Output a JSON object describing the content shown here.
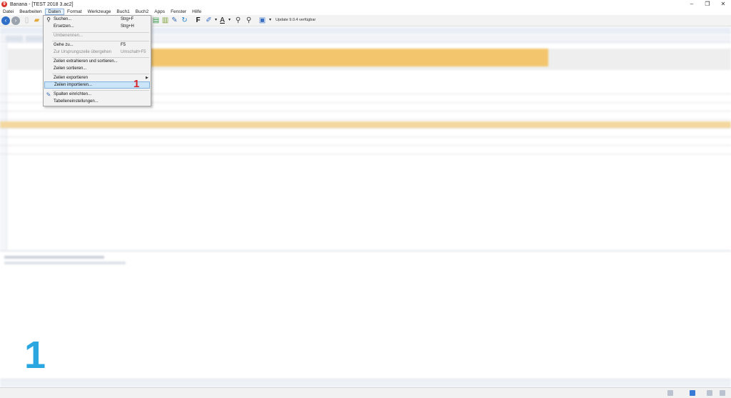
{
  "window": {
    "title": "Banana - [TEST 2018 3.ac2]",
    "controls": [
      "–",
      "❐",
      "✕"
    ]
  },
  "menubar": {
    "items": [
      "Datei",
      "Bearbeiten",
      "Daten",
      "Format",
      "Werkzeuge",
      "Buch1",
      "Buch2",
      "Apps",
      "Fenster",
      "Hilfe"
    ],
    "active": "Daten"
  },
  "toolbar": {
    "update_text": "Update 9.0.4 verfügbar",
    "bold_glyph": "F",
    "font_color_glyph": "A"
  },
  "dropdown": {
    "items": [
      {
        "label": "Suchen...",
        "shortcut": "Strg+F",
        "icon": "binoculars-icon",
        "disabled": false
      },
      {
        "label": "Ersetzen...",
        "shortcut": "Strg+H",
        "disabled": false
      },
      {
        "label": "Umbenennen...",
        "shortcut": "",
        "disabled": true
      },
      {
        "label": "Gehe zu...",
        "shortcut": "F5",
        "disabled": false
      },
      {
        "label": "Zur Ursprungszeile übergehen",
        "shortcut": "Umschalt+F5",
        "disabled": true
      },
      {
        "label": "Zeilen extrahieren und sortieren...",
        "shortcut": "",
        "disabled": false
      },
      {
        "label": "Zeilen sortieren...",
        "shortcut": "",
        "disabled": false
      },
      {
        "label": "Zeilen exportieren",
        "shortcut": "",
        "submenu": true,
        "disabled": false
      },
      {
        "label": "Zeilen importieren...",
        "shortcut": "",
        "highlighted": true,
        "disabled": false
      },
      {
        "label": "Spalten einrichten...",
        "shortcut": "",
        "icon": "pencil-ruler-icon",
        "disabled": false
      },
      {
        "label": "Tabelleneinstellungen...",
        "shortcut": "",
        "disabled": false
      }
    ]
  },
  "annotations": {
    "step_marker_small": "1",
    "step_marker_large": "1"
  },
  "colors": {
    "header_accent": "#f3c66d",
    "selected_row": "#f3d79e",
    "highlight_item": "#cce4f7",
    "step_marker_red": "#d8262b",
    "step_marker_blue": "#2aa7e0"
  }
}
